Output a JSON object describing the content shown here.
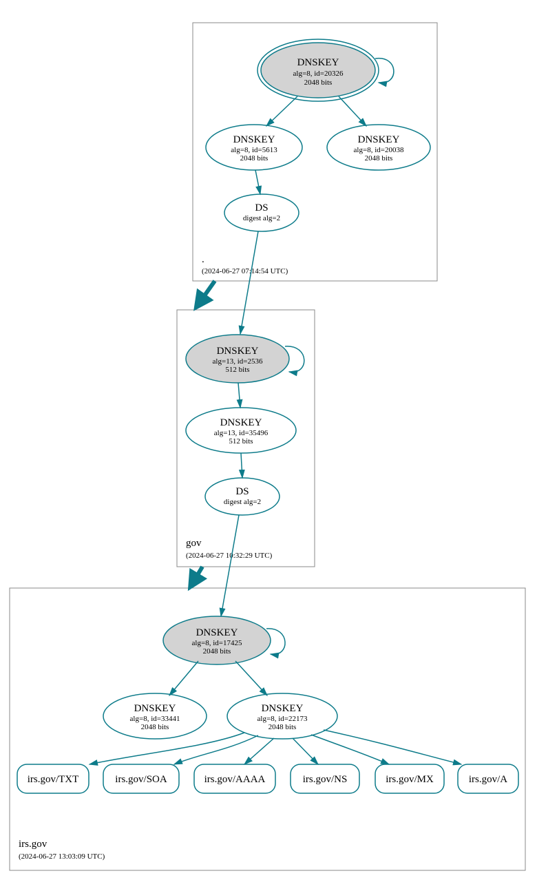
{
  "colors": {
    "stroke": "#0d7b8a",
    "ksk_fill": "#d3d3d3"
  },
  "zones": {
    "root": {
      "name": ".",
      "timestamp": "(2024-06-27 07:14:54 UTC)",
      "keys": {
        "ksk": {
          "title": "DNSKEY",
          "line1": "alg=8, id=20326",
          "line2": "2048 bits"
        },
        "zsk1": {
          "title": "DNSKEY",
          "line1": "alg=8, id=5613",
          "line2": "2048 bits"
        },
        "zsk2": {
          "title": "DNSKEY",
          "line1": "alg=8, id=20038",
          "line2": "2048 bits"
        }
      },
      "ds": {
        "title": "DS",
        "line1": "digest alg=2"
      }
    },
    "gov": {
      "name": "gov",
      "timestamp": "(2024-06-27 10:32:29 UTC)",
      "keys": {
        "ksk": {
          "title": "DNSKEY",
          "line1": "alg=13, id=2536",
          "line2": "512 bits"
        },
        "zsk": {
          "title": "DNSKEY",
          "line1": "alg=13, id=35496",
          "line2": "512 bits"
        }
      },
      "ds": {
        "title": "DS",
        "line1": "digest alg=2"
      }
    },
    "irsgov": {
      "name": "irs.gov",
      "timestamp": "(2024-06-27 13:03:09 UTC)",
      "keys": {
        "ksk": {
          "title": "DNSKEY",
          "line1": "alg=8, id=17425",
          "line2": "2048 bits"
        },
        "zsk1": {
          "title": "DNSKEY",
          "line1": "alg=8, id=33441",
          "line2": "2048 bits"
        },
        "zsk2": {
          "title": "DNSKEY",
          "line1": "alg=8, id=22173",
          "line2": "2048 bits"
        }
      },
      "rrsets": {
        "txt": "irs.gov/TXT",
        "soa": "irs.gov/SOA",
        "aaaa": "irs.gov/AAAA",
        "ns": "irs.gov/NS",
        "mx": "irs.gov/MX",
        "a": "irs.gov/A"
      }
    }
  }
}
